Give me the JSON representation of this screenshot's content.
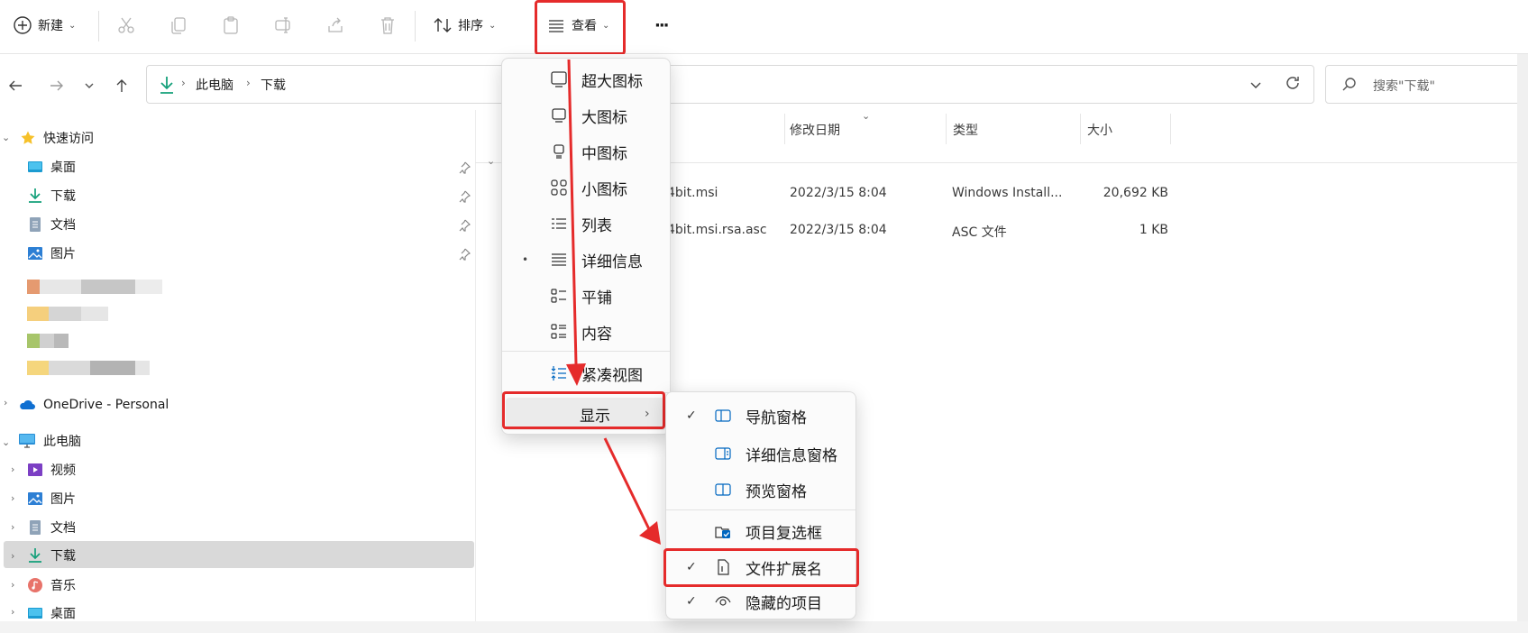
{
  "toolbar": {
    "new_label": "新建",
    "sort_label": "排序",
    "view_label": "查看",
    "more_label": "···",
    "icons": [
      "cut-icon",
      "copy-icon",
      "paste-icon",
      "rename-icon",
      "share-icon",
      "delete-icon"
    ]
  },
  "address": {
    "crumbs": [
      "此电脑",
      "下载"
    ],
    "search_placeholder": "搜索\"下载\""
  },
  "sidebar": {
    "quick_access": "快速访问",
    "quick_items": [
      "桌面",
      "下载",
      "文档",
      "图片"
    ],
    "onedrive": "OneDrive - Personal",
    "this_pc": "此电脑",
    "pc_items": [
      "视频",
      "图片",
      "文档",
      "下载",
      "音乐",
      "桌面"
    ],
    "selected": "下载"
  },
  "content": {
    "columns": [
      "修改日期",
      "类型",
      "大小"
    ],
    "rows": [
      {
        "name": "4bit.msi",
        "date": "2022/3/15 8:04",
        "type": "Windows Install...",
        "size": "20,692 KB"
      },
      {
        "name": "4bit.msi.rsa.asc",
        "date": "2022/3/15 8:04",
        "type": "ASC 文件",
        "size": "1 KB"
      }
    ]
  },
  "view_menu": {
    "items": [
      "超大图标",
      "大图标",
      "中图标",
      "小图标",
      "列表",
      "详细信息",
      "平铺",
      "内容"
    ],
    "selected": "详细信息",
    "compact": "紧凑视图",
    "show": "显示"
  },
  "show_menu": {
    "items": [
      "导航窗格",
      "详细信息窗格",
      "预览窗格",
      "项目复选框",
      "文件扩展名",
      "隐藏的项目"
    ],
    "checked": [
      "导航窗格",
      "文件扩展名",
      "隐藏的项目"
    ],
    "check_glyph": "✓",
    "bullet_glyph": "•"
  },
  "colors": {
    "highlight": "#e52b2b",
    "accent": "#0067c0",
    "selection": "#d9d9d9"
  }
}
